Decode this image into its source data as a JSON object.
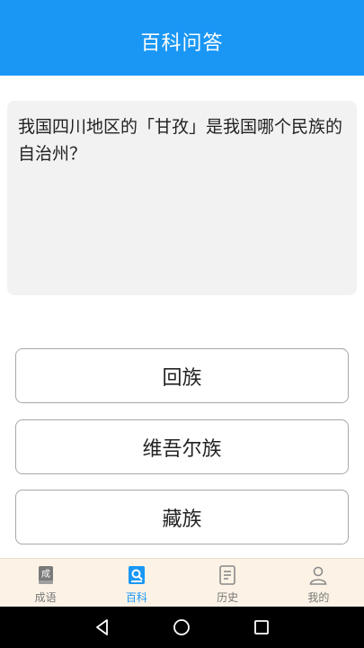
{
  "header": {
    "title": "百科问答"
  },
  "question": {
    "text": "我国四川地区的「甘孜」是我国哪个民族的自治州？"
  },
  "options": [
    {
      "label": "回族"
    },
    {
      "label": "维吾尔族"
    },
    {
      "label": "藏族"
    }
  ],
  "tabs": [
    {
      "label": "成语",
      "icon": "idiom-book-icon",
      "glyph": "成",
      "active": false
    },
    {
      "label": "百科",
      "icon": "encyclopedia-search-icon",
      "active": true
    },
    {
      "label": "历史",
      "icon": "history-document-icon",
      "active": false
    },
    {
      "label": "我的",
      "icon": "user-profile-icon",
      "active": false
    }
  ],
  "colors": {
    "accent": "#1a97f5",
    "tabbar_bg": "#fcf3e6",
    "card_bg": "#f2f2f2"
  }
}
